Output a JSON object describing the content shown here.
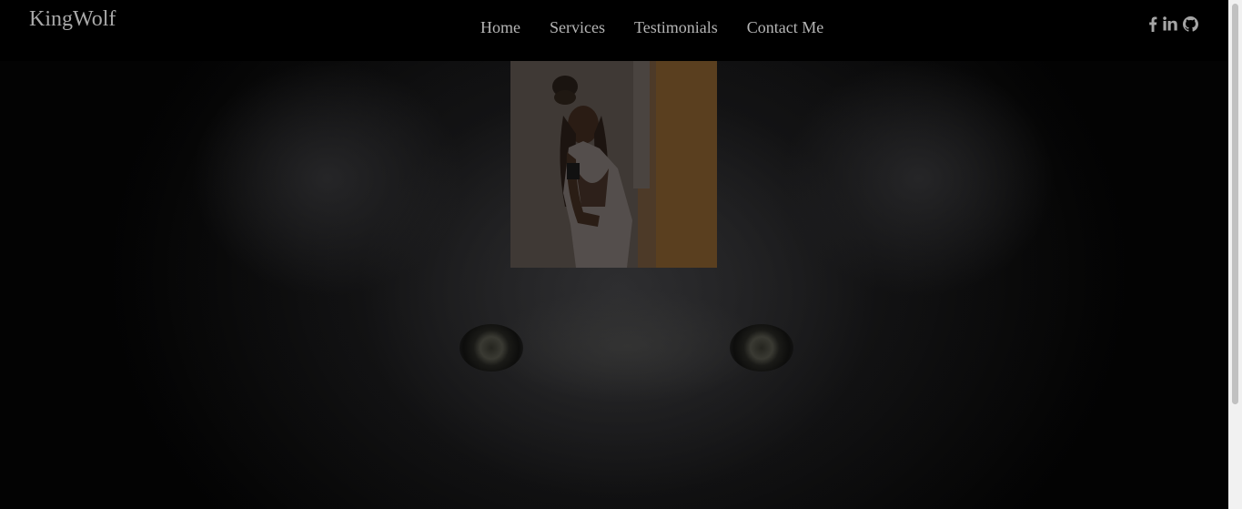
{
  "header": {
    "brand": "KingWolf",
    "nav": [
      {
        "label": "Home"
      },
      {
        "label": "Services"
      },
      {
        "label": "Testimonials"
      },
      {
        "label": "Contact Me"
      }
    ],
    "social": [
      {
        "icon": "facebook-icon"
      },
      {
        "icon": "linkedin-icon"
      },
      {
        "icon": "github-icon"
      }
    ]
  },
  "hero": {
    "background": "wolf-face-photo",
    "profile_image": "portrait-photo"
  },
  "colors": {
    "header_bg": "#000000",
    "nav_text": "#b5b5b5",
    "brand_text": "#a8a8a8"
  }
}
